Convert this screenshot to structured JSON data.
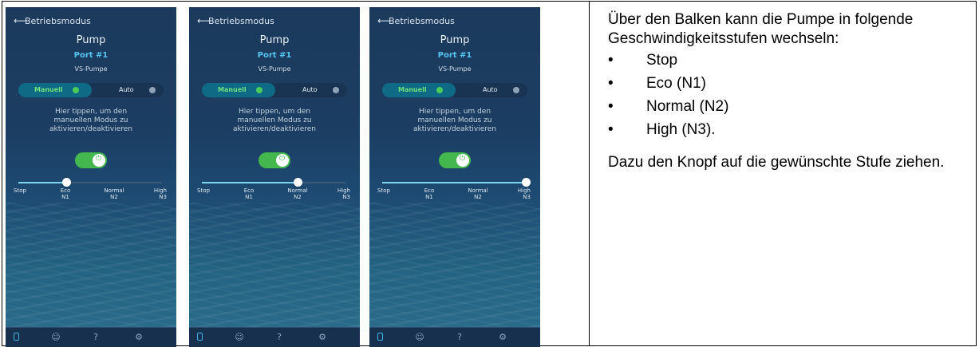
{
  "screens": [
    {
      "back_label": "Betriebsmodus",
      "device": "Pump",
      "port": "Port #1",
      "type": "VS-Pumpe",
      "mode_manual": "Manuell",
      "mode_auto": "Auto",
      "hint": [
        "Hier tippen, um den",
        "manuellen Modus zu",
        "aktivieren/deaktivieren"
      ],
      "speed_level": 1
    },
    {
      "back_label": "Betriebsmodus",
      "device": "Pump",
      "port": "Port #1",
      "type": "VS-Pumpe",
      "mode_manual": "Manuell",
      "mode_auto": "Auto",
      "hint": [
        "Hier tippen, um den",
        "manuellen Modus zu",
        "aktivieren/deaktivieren"
      ],
      "speed_level": 2
    },
    {
      "back_label": "Betriebsmodus",
      "device": "Pump",
      "port": "Port #1",
      "type": "VS-Pumpe",
      "mode_manual": "Manuell",
      "mode_auto": "Auto",
      "hint": [
        "Hier tippen, um den",
        "manuellen Modus zu",
        "aktivieren/deaktivieren"
      ],
      "speed_level": 3
    }
  ],
  "speed_labels": [
    {
      "name": "Stop",
      "code": ""
    },
    {
      "name": "Eco",
      "code": "N1"
    },
    {
      "name": "Normal",
      "code": "N2"
    },
    {
      "name": "High",
      "code": "N3"
    }
  ],
  "nav_icons": [
    "phone-icon",
    "smiley-icon",
    "help-icon",
    "settings-icon"
  ],
  "description": {
    "intro": "Über den Balken kann die Pumpe in folgende Geschwindigkeitsstufen wechseln:",
    "bullet_char": "•",
    "items": [
      "Stop",
      "Eco (N1)",
      "Normal (N2)",
      "High (N3)."
    ],
    "outro": "Dazu den Knopf auf die gewünschte Stufe ziehen."
  },
  "colors": {
    "accent": "#56c6f2",
    "toggle_on": "#44b84e"
  }
}
